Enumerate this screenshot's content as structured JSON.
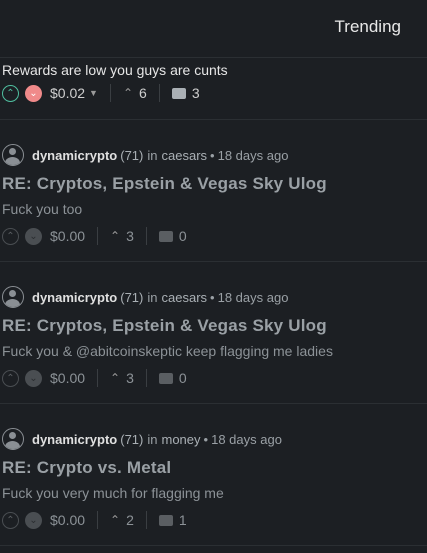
{
  "header": {
    "trending": "Trending"
  },
  "top_item": {
    "text": "Rewards are low you guys are cunts",
    "payout": "$0.02",
    "votes": "6",
    "replies": "3"
  },
  "comments": [
    {
      "author": "dynamicrypto",
      "rep": "(71)",
      "in": "in",
      "category": "caesars",
      "age": "18 days ago",
      "title": "RE: Cryptos, Epstein & Vegas Sky Ulog",
      "text": "Fuck you too",
      "payout": "$0.00",
      "votes": "3",
      "replies": "0"
    },
    {
      "author": "dynamicrypto",
      "rep": "(71)",
      "in": "in",
      "category": "caesars",
      "age": "18 days ago",
      "title": "RE: Cryptos, Epstein & Vegas Sky Ulog",
      "text": "Fuck you & @abitcoinskeptic keep flagging me ladies",
      "payout": "$0.00",
      "votes": "3",
      "replies": "0"
    },
    {
      "author": "dynamicrypto",
      "rep": "(71)",
      "in": "in",
      "category": "money",
      "age": "18 days ago",
      "title": "RE: Crypto vs. Metal",
      "text": "Fuck you very much for flagging me",
      "payout": "$0.00",
      "votes": "2",
      "replies": "1"
    }
  ],
  "colors": {
    "background": "#1c1f23",
    "upvote_accent": "#4fbf9f",
    "downvote_accent": "#f08a8a"
  }
}
